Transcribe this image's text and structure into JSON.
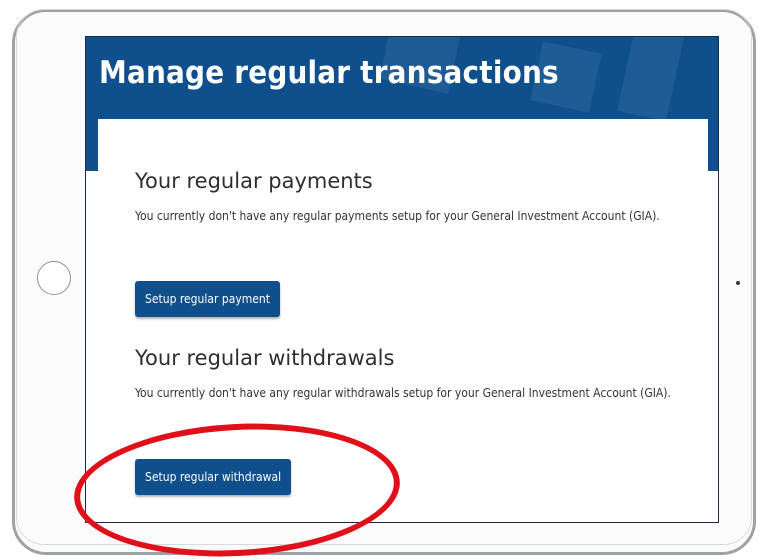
{
  "page": {
    "title": "Manage regular transactions"
  },
  "payments": {
    "heading": "Your regular payments",
    "description": "You currently don't have any regular payments setup for your General Investment Account (GIA).",
    "button_label": "Setup regular payment"
  },
  "withdrawals": {
    "heading": "Your regular withdrawals",
    "description": "You currently don't have any regular withdrawals setup for your General Investment Account (GIA).",
    "button_label": "Setup regular withdrawal"
  },
  "colors": {
    "brand_blue": "#0f4f8c",
    "annotation_red": "#e0101a"
  },
  "icons": [
    "home-button-icon",
    "camera-icon"
  ]
}
